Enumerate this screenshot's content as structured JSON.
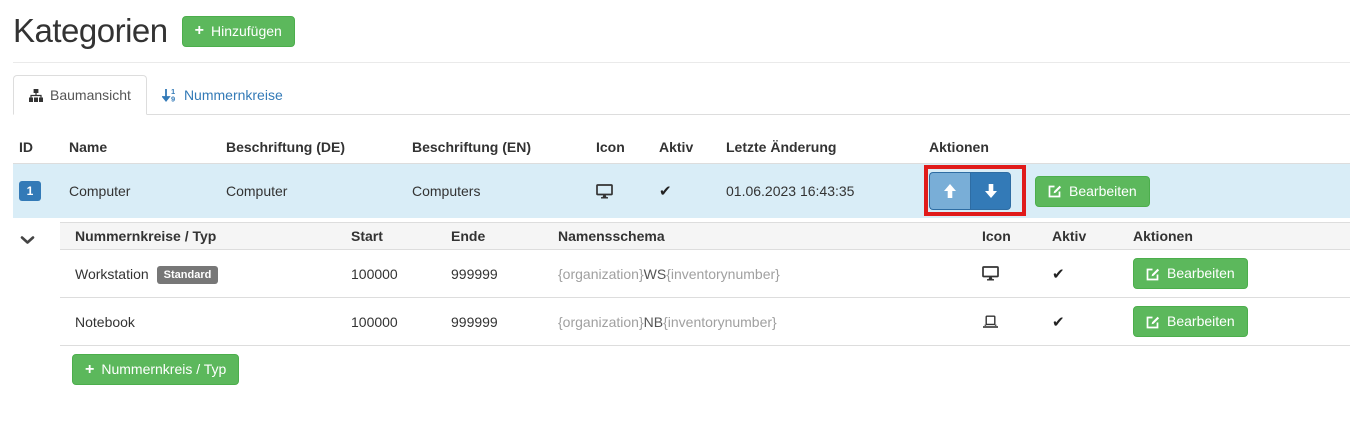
{
  "page": {
    "title": "Kategorien"
  },
  "header": {
    "add_button_label": "Hinzufügen"
  },
  "icons": {
    "plus": "+",
    "check": "✔"
  },
  "colors": {
    "accent_green": "#5cb85c",
    "primary_blue": "#337ab7",
    "row_highlight": "#d9edf7",
    "annotation_red": "#e01b1b",
    "badge_gray": "#777"
  },
  "tabs": [
    {
      "label": "Baumansicht",
      "icon": "sitemap-icon",
      "active": true
    },
    {
      "label": "Nummernkreise",
      "icon": "sort-numeric-icon",
      "active": false
    }
  ],
  "table": {
    "columns": [
      "ID",
      "Name",
      "Beschriftung (DE)",
      "Beschriftung (EN)",
      "Icon",
      "Aktiv",
      "Letzte Änderung",
      "Aktionen"
    ],
    "row": {
      "id": "1",
      "name": "Computer",
      "label_de": "Computer",
      "label_en": "Computers",
      "icon": "desktop-icon",
      "active": true,
      "last_change": "01.06.2023 16:43:35",
      "edit_label": "Bearbeiten"
    }
  },
  "subtable": {
    "columns": [
      "Nummernkreise / Typ",
      "Start",
      "Ende",
      "Namensschema",
      "Icon",
      "Aktiv",
      "Aktionen"
    ],
    "rows": [
      {
        "name": "Workstation",
        "badge": "Standard",
        "start": "100000",
        "end": "999999",
        "schema_prefix": "{organization}",
        "schema_code": "WS",
        "schema_suffix": "{inventorynumber}",
        "icon": "desktop-icon",
        "active": true,
        "edit_label": "Bearbeiten"
      },
      {
        "name": "Notebook",
        "start": "100000",
        "end": "999999",
        "schema_prefix": "{organization}",
        "schema_code": "NB",
        "schema_suffix": "{inventorynumber}",
        "icon": "laptop-icon",
        "active": true,
        "edit_label": "Bearbeiten"
      }
    ],
    "add_button_label": "Nummernkreis / Typ"
  }
}
